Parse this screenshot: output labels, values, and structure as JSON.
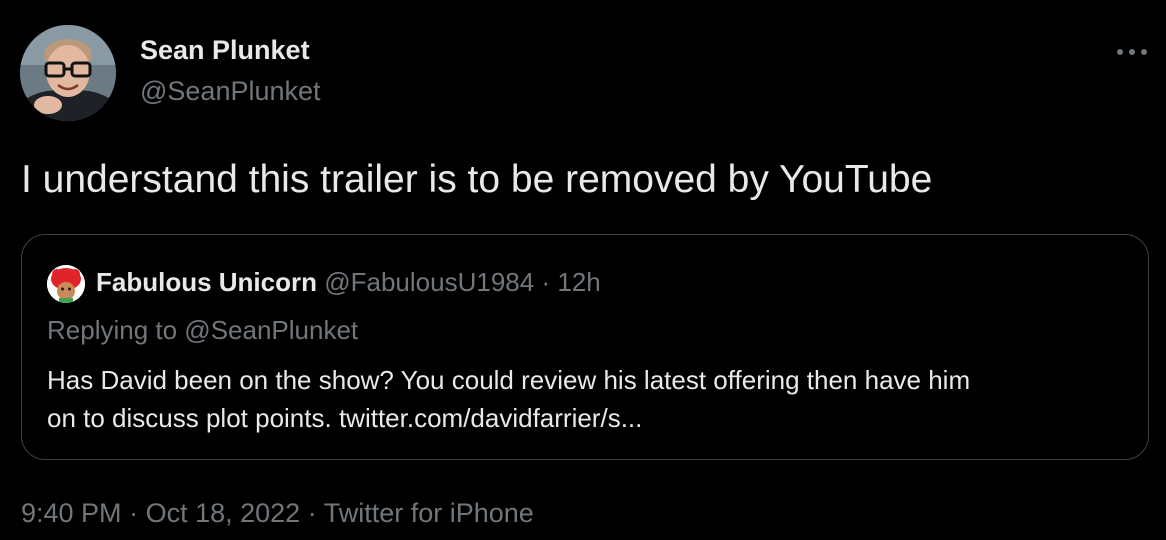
{
  "author": {
    "name": "Sean Plunket",
    "handle": "@SeanPlunket"
  },
  "tweet": {
    "text": "I understand this trailer is to be removed by YouTube"
  },
  "quoted_tweet": {
    "name": "Fabulous Unicorn",
    "handle": "@FabulousU1984",
    "separator": "·",
    "time": "12h",
    "replying_to": "Replying to @SeanPlunket",
    "body_line1": "Has David been on the show? You could review his latest offering then have him",
    "body_line2": "on to discuss plot points. twitter.com/davidfarrier/s..."
  },
  "meta": {
    "time": "9:40 PM",
    "separator1": "·",
    "date": "Oct 18, 2022",
    "separator2": "·",
    "source": "Twitter for iPhone"
  },
  "icons": {
    "more": "more-horizontal-icon",
    "avatar": "avatar",
    "quote_avatar": "quote-avatar"
  },
  "colors": {
    "background": "#000000",
    "primary_text": "#e7e9ea",
    "secondary_text": "#71767b",
    "border": "#3e4144"
  }
}
